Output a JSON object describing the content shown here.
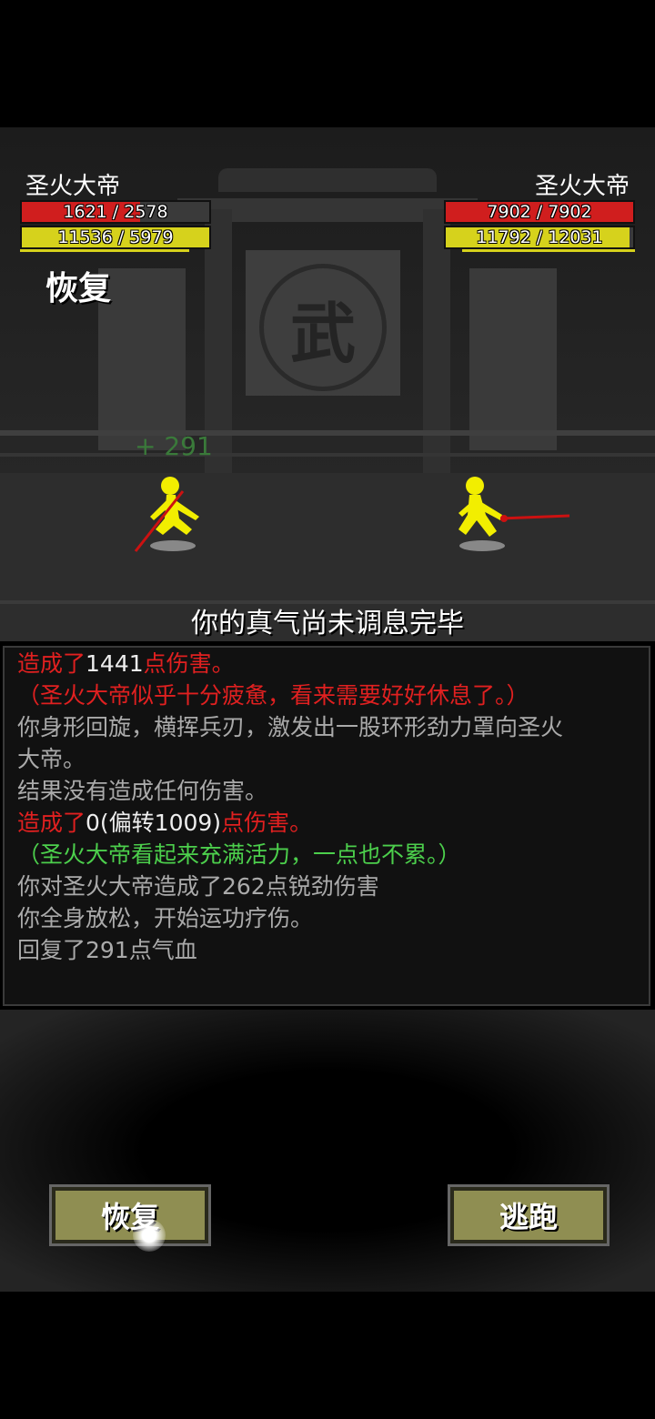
{
  "player": {
    "name": "圣火大帝",
    "hp_text": "1621 / 2578",
    "hp_fraction": 0.629,
    "qi_text": "11536 / 5979",
    "qi_fraction": 1.0,
    "status": "恢复",
    "heal_float": "+ 291"
  },
  "enemy": {
    "name": "圣火大帝",
    "hp_text": "7902 / 7902",
    "hp_fraction": 1.0,
    "qi_text": "11792 / 12031",
    "qi_fraction": 0.98
  },
  "scene": {
    "emblem": "武",
    "message": "你的真气尚未调息完毕"
  },
  "log": {
    "lines": [
      {
        "parts": [
          {
            "text": "造成了",
            "color": "red"
          },
          {
            "text": "1441",
            "color": "white"
          },
          {
            "text": "点伤害。",
            "color": "red"
          }
        ]
      },
      {
        "parts": [
          {
            "text": "（圣火大帝似乎十分疲惫，看来需要好好休息了。）",
            "color": "red"
          }
        ]
      },
      {
        "parts": [
          {
            "text": "你身形回旋，横挥兵刃，激发出一股环形劲力罩向圣火",
            "color": "gray"
          }
        ]
      },
      {
        "parts": [
          {
            "text": "大帝。",
            "color": "gray"
          }
        ]
      },
      {
        "parts": [
          {
            "text": "结果没有造成任何伤害。",
            "color": "gray"
          }
        ]
      },
      {
        "parts": [
          {
            "text": "造成了",
            "color": "red"
          },
          {
            "text": "0(偏转1009)",
            "color": "white"
          },
          {
            "text": "点伤害。",
            "color": "red"
          }
        ]
      },
      {
        "parts": [
          {
            "text": "（圣火大帝看起来充满活力，一点也不累。）",
            "color": "green"
          }
        ]
      },
      {
        "parts": [
          {
            "text": "你对圣火大帝造成了262点锐劲伤害",
            "color": "gray"
          }
        ]
      },
      {
        "parts": [
          {
            "text": "你全身放松，开始运功疗伤。",
            "color": "gray"
          }
        ]
      },
      {
        "parts": [
          {
            "text": "回复了291点气血",
            "color": "gray"
          }
        ]
      }
    ]
  },
  "actions": {
    "recover_label": "恢复",
    "flee_label": "逃跑"
  },
  "colors": {
    "hp": "#d01e1e",
    "qi": "#d6d21c",
    "fighter": "#f2ee00",
    "weapon": "#cc1111",
    "button": "#8f8e52"
  }
}
